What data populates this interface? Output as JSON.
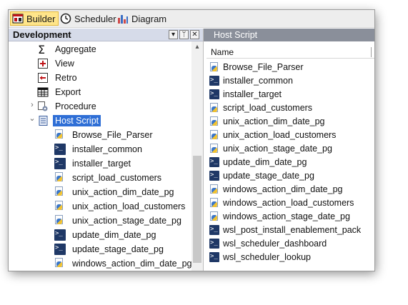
{
  "toolbar": {
    "tabs": [
      {
        "label": "Builder",
        "icon": "builder-icon",
        "active": true
      },
      {
        "label": "Scheduler",
        "icon": "clock-icon",
        "active": false
      },
      {
        "label": "Diagram",
        "icon": "diagram-icon",
        "active": false
      }
    ]
  },
  "left_panel": {
    "title": "Development",
    "buttons": {
      "dropdown": "▾",
      "pin": "ᛘ",
      "close": "✕"
    },
    "scroll_up": "▴",
    "tree": [
      {
        "label": "Aggregate",
        "icon": "sigma-icon"
      },
      {
        "label": "View",
        "icon": "view-icon"
      },
      {
        "label": "Retro",
        "icon": "retro-icon"
      },
      {
        "label": "Export",
        "icon": "export-icon"
      },
      {
        "label": "Procedure",
        "icon": "procedure-icon",
        "expander": "›"
      },
      {
        "label": "Host Script",
        "icon": "host-script-icon",
        "expander": "⌄",
        "selected": true
      }
    ],
    "children": [
      {
        "label": "Browse_File_Parser",
        "icon": "python-script-icon"
      },
      {
        "label": "installer_common",
        "icon": "powershell-icon"
      },
      {
        "label": "installer_target",
        "icon": "powershell-icon"
      },
      {
        "label": "script_load_customers",
        "icon": "python-script-icon"
      },
      {
        "label": "unix_action_dim_date_pg",
        "icon": "python-script-icon"
      },
      {
        "label": "unix_action_load_customers",
        "icon": "python-script-icon"
      },
      {
        "label": "unix_action_stage_date_pg",
        "icon": "python-script-icon"
      },
      {
        "label": "update_dim_date_pg",
        "icon": "powershell-icon"
      },
      {
        "label": "update_stage_date_pg",
        "icon": "powershell-icon"
      },
      {
        "label": "windows_action_dim_date_pg",
        "icon": "python-script-icon"
      }
    ]
  },
  "right_panel": {
    "title": "Host Script",
    "column_header": "Name",
    "rows": [
      {
        "label": "Browse_File_Parser",
        "icon": "python-script-icon"
      },
      {
        "label": "installer_common",
        "icon": "powershell-icon"
      },
      {
        "label": "installer_target",
        "icon": "powershell-icon"
      },
      {
        "label": "script_load_customers",
        "icon": "python-script-icon"
      },
      {
        "label": "unix_action_dim_date_pg",
        "icon": "python-script-icon"
      },
      {
        "label": "unix_action_load_customers",
        "icon": "python-script-icon"
      },
      {
        "label": "unix_action_stage_date_pg",
        "icon": "python-script-icon"
      },
      {
        "label": "update_dim_date_pg",
        "icon": "powershell-icon"
      },
      {
        "label": "update_stage_date_pg",
        "icon": "powershell-icon"
      },
      {
        "label": "windows_action_dim_date_pg",
        "icon": "python-script-icon"
      },
      {
        "label": "windows_action_load_customers",
        "icon": "python-script-icon"
      },
      {
        "label": "windows_action_stage_date_pg",
        "icon": "python-script-icon"
      },
      {
        "label": "wsl_post_install_enablement_pack",
        "icon": "powershell-icon"
      },
      {
        "label": "wsl_scheduler_dashboard",
        "icon": "powershell-icon"
      },
      {
        "label": "wsl_scheduler_lookup",
        "icon": "powershell-icon"
      }
    ]
  },
  "colors": {
    "active_tab_bg": "#ffe58a",
    "selection": "#2f6fd6",
    "panel_header_left": "#d6dbe9",
    "panel_header_right": "#8a8f9a"
  }
}
